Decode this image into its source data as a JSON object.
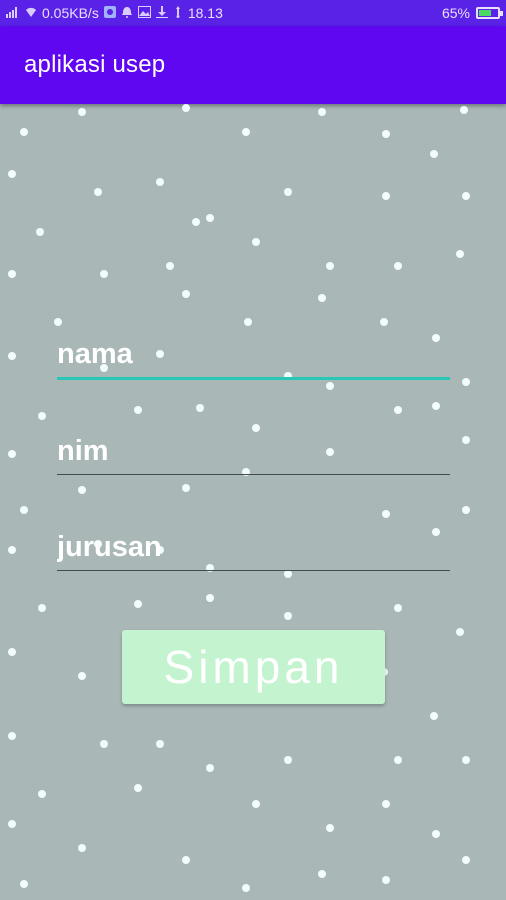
{
  "status_bar": {
    "network_speed": "0.05KB/s",
    "time": "18.13",
    "battery_percent": "65%",
    "battery_level": 0.65,
    "icons": [
      "signal-icon",
      "wifi-icon",
      "app-notification-icon",
      "alarm-icon",
      "gallery-icon",
      "download-icon",
      "usb-icon"
    ]
  },
  "app_bar": {
    "title": "aplikasi usep"
  },
  "form": {
    "nama_placeholder": "nama",
    "nim_placeholder": "nim",
    "jurusan_placeholder": "jurusan",
    "save_label": "Simpan"
  },
  "colors": {
    "status_bar": "#5a21e6",
    "app_bar": "#5f07f0",
    "background": "#a9b7b7",
    "focus_underline": "#28c8b8",
    "button": "#c4f3cf"
  }
}
